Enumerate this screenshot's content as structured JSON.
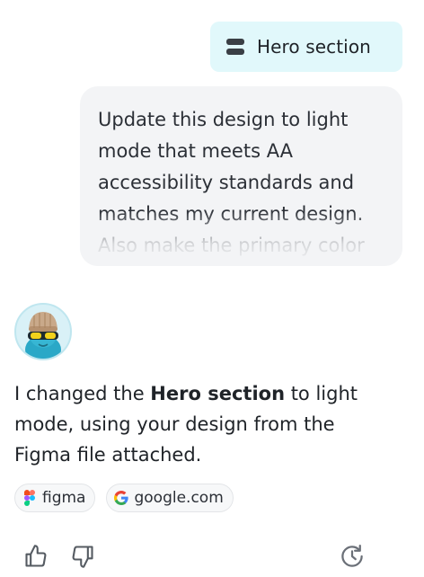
{
  "section_chip": {
    "label": "Hero section",
    "icon": "section-icon"
  },
  "user_message": {
    "text": "Update this design to light mode that meets AA accessibility standards and matches my current design. Also make the primary color"
  },
  "assistant": {
    "avatar": "avatar-character",
    "message": {
      "before": "I changed the ",
      "bold": "Hero section",
      "after": " to light mode, using your design from the Figma file attached."
    }
  },
  "sources": [
    {
      "label": "figma",
      "icon": "figma-icon"
    },
    {
      "label": "google.com",
      "icon": "google-icon"
    }
  ],
  "actions": {
    "thumbs_up": "thumbs-up-icon",
    "thumbs_down": "thumbs-down-icon",
    "history": "history-icon"
  },
  "colors": {
    "chip_bg": "#e1f8fb",
    "bubble_bg": "#f3f4f6",
    "text": "#1f2328",
    "icon": "#6b7078"
  }
}
